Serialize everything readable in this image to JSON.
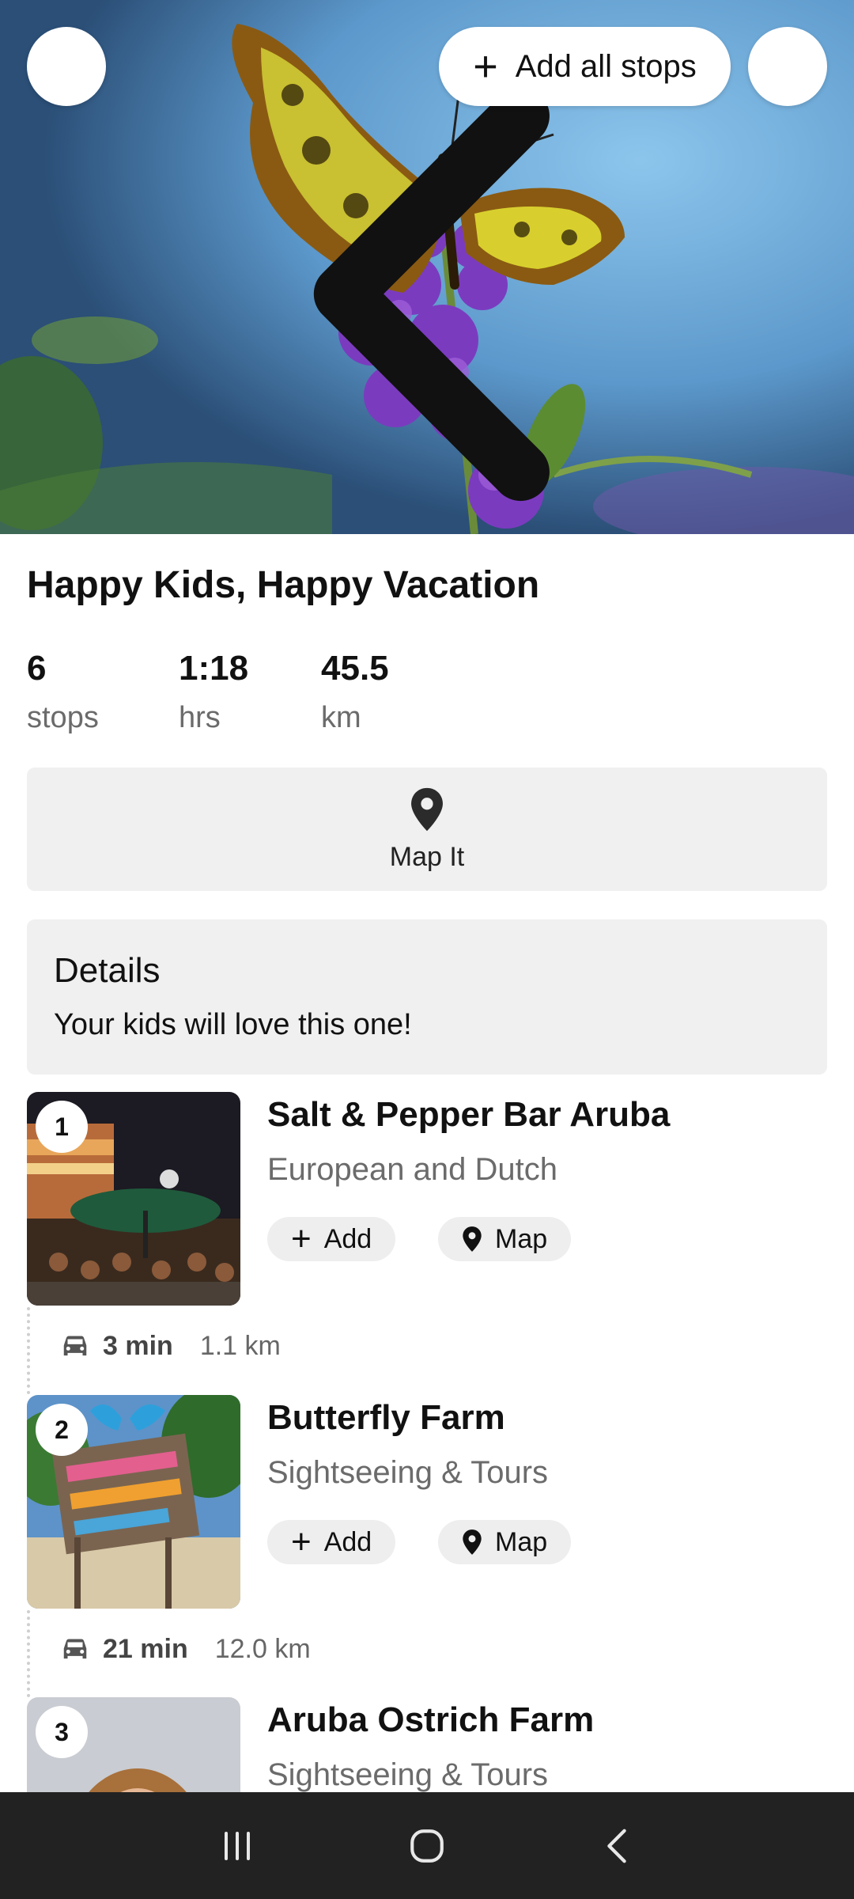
{
  "hero": {
    "add_all_label": "Add all stops",
    "icons": {
      "back": "chevron-left-icon",
      "share": "share-icon",
      "add": "plus-icon"
    }
  },
  "tour": {
    "title": "Happy Kids, Happy Vacation",
    "stats": [
      {
        "value": "6",
        "unit": "stops"
      },
      {
        "value": "1:18",
        "unit": "hrs"
      },
      {
        "value": "45.5",
        "unit": "km"
      }
    ],
    "map_it_label": "Map It",
    "details_title": "Details",
    "details_text": "Your kids will love this one!"
  },
  "stops": [
    {
      "number": "1",
      "name": "Salt & Pepper Bar Aruba",
      "category": "European and Dutch",
      "add_label": "Add",
      "map_label": "Map"
    },
    {
      "number": "2",
      "name": "Butterfly Farm",
      "category": "Sightseeing & Tours",
      "add_label": "Add",
      "map_label": "Map"
    },
    {
      "number": "3",
      "name": "Aruba Ostrich Farm",
      "category": "Sightseeing & Tours"
    }
  ],
  "legs": [
    {
      "time": "3 min",
      "distance": "1.1 km"
    },
    {
      "time": "21 min",
      "distance": "12.0 km"
    }
  ],
  "colors": {
    "panel_bg": "#f0f0f0",
    "pill_bg": "#eeeeee",
    "muted_text": "#6b6b6b",
    "navbar_bg": "#222222"
  }
}
